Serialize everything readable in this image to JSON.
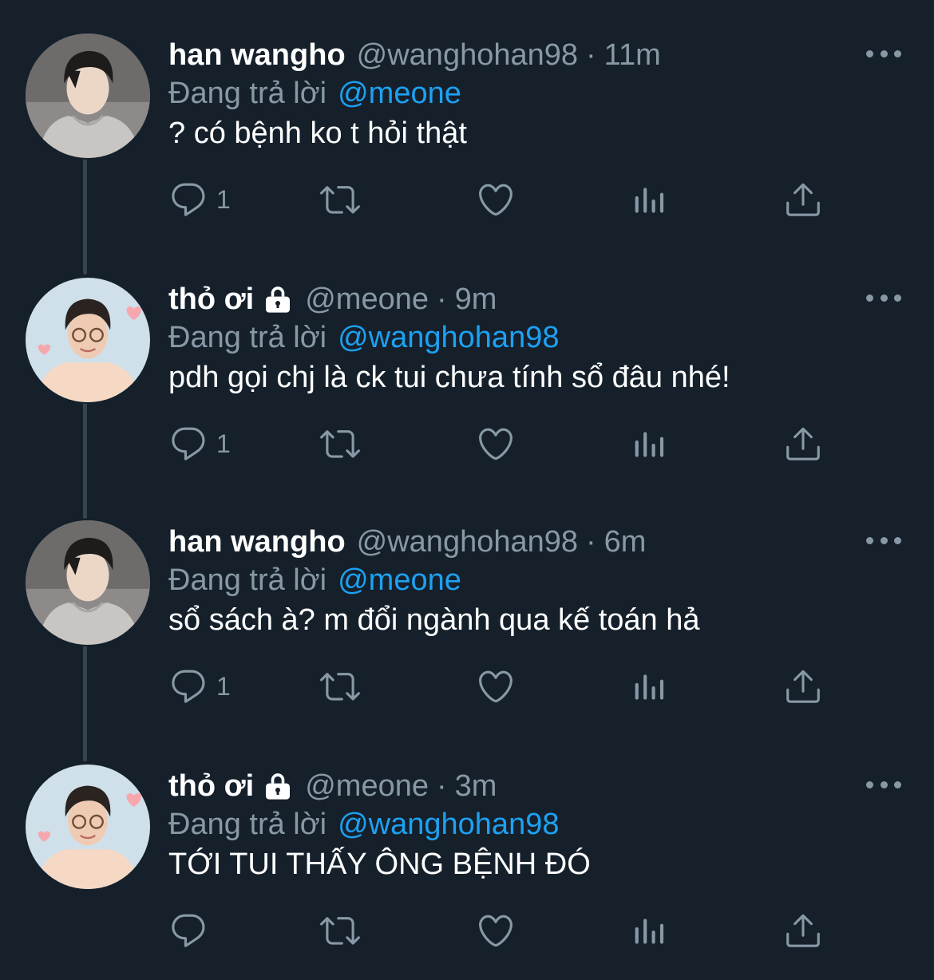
{
  "colors": {
    "background": "#15202b",
    "secondary_text": "#8899a6",
    "mention": "#1da1f2",
    "thread_line": "#38444d"
  },
  "tweets": [
    {
      "name": "han wangho",
      "locked": false,
      "handle": "@wanghohan98",
      "dot": "·",
      "time": "11m",
      "reply_prefix": "Đang trả lời",
      "reply_to": "@meone",
      "text": "? có bệnh ko t hỏi thật",
      "reply_count": "1",
      "avatar": "gray-hoodie-avatar"
    },
    {
      "name": "thỏ ơi",
      "locked": true,
      "handle": "@meone",
      "dot": "·",
      "time": "9m",
      "reply_prefix": "Đang trả lời",
      "reply_to": "@wanghohan98",
      "text": "pdh gọi chj là ck tui chưa tính sổ đâu nhé!",
      "reply_count": "1",
      "avatar": "glasses-hearts-avatar"
    },
    {
      "name": "han wangho",
      "locked": false,
      "handle": "@wanghohan98",
      "dot": "·",
      "time": "6m",
      "reply_prefix": "Đang trả lời",
      "reply_to": "@meone",
      "text": "sổ sách à? m đổi ngành qua kế toán hả",
      "reply_count": "1",
      "avatar": "gray-hoodie-avatar"
    },
    {
      "name": "thỏ ơi",
      "locked": true,
      "handle": "@meone",
      "dot": "·",
      "time": "3m",
      "reply_prefix": "Đang trả lời",
      "reply_to": "@wanghohan98",
      "text": "TỚI TUI THẤY ÔNG BỆNH ĐÓ",
      "reply_count": "",
      "avatar": "glasses-hearts-avatar"
    }
  ],
  "icons": {
    "reply": "reply-icon",
    "retweet": "retweet-icon",
    "like": "heart-icon",
    "analytics": "analytics-icon",
    "share": "share-icon",
    "more": "more-icon",
    "lock": "lock-icon"
  }
}
